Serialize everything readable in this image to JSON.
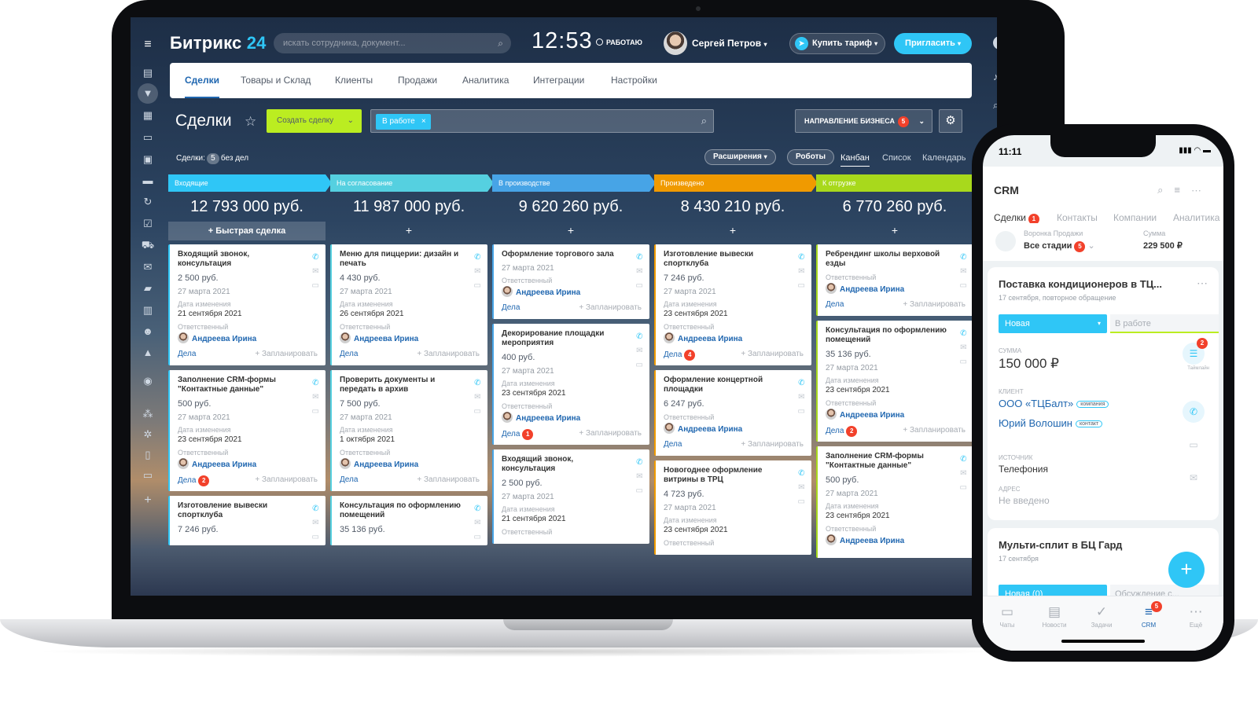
{
  "app": {
    "logo_main": "Битрикс",
    "logo_num": "24",
    "search_placeholder": "искать сотрудника, документ...",
    "clock": "12:53",
    "work_status": "РАБОТАЮ",
    "user_name": "Сергей Петров",
    "buy_tariff": "Купить тариф",
    "invite": "Пригласить",
    "help": "?"
  },
  "tabs": [
    "Сделки",
    "Товары и Склад",
    "Клиенты",
    "Продажи",
    "Аналитика",
    "Интеграции",
    "Настройки"
  ],
  "toolbar": {
    "title": "Сделки",
    "create_deal": "Создать сделку",
    "filter_chip": "В работе",
    "direction": "НАПРАВЛЕНИЕ БИЗНЕСА",
    "direction_badge": "5"
  },
  "subbar": {
    "deals_label": "Сделки:",
    "deals_count": "5",
    "deals_suffix": "без дел",
    "extensions": "Расширения",
    "robots": "Роботы",
    "views": [
      "Канбан",
      "Список",
      "Календарь"
    ]
  },
  "colors": {
    "accent": "#2fc6f6",
    "create": "#bbed21",
    "link": "#2067b0",
    "badge": "#f2412b"
  },
  "columns": [
    {
      "name": "Входящие",
      "color": "#2fc6f6",
      "sum": "12 793 000 руб.",
      "add": "+ Быстрая сделка",
      "cards": [
        {
          "title": "Входящий звонок, консультация",
          "price": "2 500 руб.",
          "date": "27 марта 2021",
          "changed_label": "Дата изменения",
          "changed": "21 сентября 2021",
          "resp_label": "Ответственный",
          "resp": "Андреева Ирина",
          "tasks": "Дела",
          "badge": "",
          "plan": "+ Запланировать"
        },
        {
          "title": "Заполнение CRM-формы \"Контактные данные\"",
          "price": "500 руб.",
          "date": "27 марта 2021",
          "changed_label": "Дата изменения",
          "changed": "23 сентября 2021",
          "resp_label": "Ответственный",
          "resp": "Андреева Ирина",
          "tasks": "Дела",
          "badge": "2",
          "plan": "+ Запланировать"
        },
        {
          "title": "Изготовление вывески спортклуба",
          "price": "7 246 руб.",
          "date": "",
          "changed_label": "",
          "changed": "",
          "resp_label": "",
          "resp": "",
          "tasks": "",
          "badge": "",
          "plan": ""
        }
      ]
    },
    {
      "name": "На согласование",
      "color": "#55d0e0",
      "sum": "11 987 000 руб.",
      "add": "+",
      "cards": [
        {
          "title": "Меню для пиццерии: дизайн и печать",
          "price": "4 430 руб.",
          "date": "27 марта 2021",
          "changed_label": "Дата изменения",
          "changed": "26 сентября 2021",
          "resp_label": "Ответственный",
          "resp": "Андреева Ирина",
          "tasks": "Дела",
          "badge": "",
          "plan": "+ Запланировать"
        },
        {
          "title": "Проверить документы и передать в архив",
          "price": "7 500 руб.",
          "date": "27 марта 2021",
          "changed_label": "Дата изменения",
          "changed": "1 октября 2021",
          "resp_label": "Ответственный",
          "resp": "Андреева Ирина",
          "tasks": "Дела",
          "badge": "",
          "plan": "+ Запланировать"
        },
        {
          "title": "Консультация по оформлению помещений",
          "price": "35 136 руб.",
          "date": "",
          "changed_label": "",
          "changed": "",
          "resp_label": "",
          "resp": "",
          "tasks": "",
          "badge": "",
          "plan": ""
        }
      ]
    },
    {
      "name": "В производстве",
      "color": "#47a4e6",
      "sum": "9 620 260 руб.",
      "add": "+",
      "cards": [
        {
          "title": "Оформление торгового зала",
          "price": "",
          "date": "27 марта 2021",
          "changed_label": "",
          "changed": "",
          "resp_label": "Ответственный",
          "resp": "Андреева Ирина",
          "tasks": "Дела",
          "badge": "",
          "plan": "+ Запланировать"
        },
        {
          "title": "Декорирование площадки мероприятия",
          "price": "400 руб.",
          "date": "27 марта 2021",
          "changed_label": "Дата изменения",
          "changed": "23 сентября 2021",
          "resp_label": "Ответственный",
          "resp": "Андреева Ирина",
          "tasks": "Дела",
          "badge": "1",
          "plan": "+ Запланировать"
        },
        {
          "title": "Входящий звонок, консультация",
          "price": "2 500 руб.",
          "date": "27 марта 2021",
          "changed_label": "Дата изменения",
          "changed": "21 сентября 2021",
          "resp_label": "Ответственный",
          "resp": "",
          "tasks": "",
          "badge": "",
          "plan": ""
        }
      ]
    },
    {
      "name": "Произведено",
      "color": "#f09a00",
      "sum": "8 430 210 руб.",
      "add": "+",
      "cards": [
        {
          "title": "Изготовление вывески спортклуба",
          "price": "7 246 руб.",
          "date": "27 марта 2021",
          "changed_label": "Дата изменения",
          "changed": "23 сентября 2021",
          "resp_label": "Ответственный",
          "resp": "Андреева Ирина",
          "tasks": "Дела",
          "badge": "4",
          "plan": "+ Запланировать"
        },
        {
          "title": "Оформление концертной площадки",
          "price": "6 247 руб.",
          "date": "",
          "changed_label": "",
          "changed": "",
          "resp_label": "Ответственный",
          "resp": "Андреева Ирина",
          "tasks": "Дела",
          "badge": "",
          "plan": "+ Запланировать"
        },
        {
          "title": "Новогоднее оформление витрины в ТРЦ",
          "price": "4 723 руб.",
          "date": "27 марта 2021",
          "changed_label": "Дата изменения",
          "changed": "23 сентября 2021",
          "resp_label": "Ответственный",
          "resp": "",
          "tasks": "",
          "badge": "",
          "plan": ""
        }
      ]
    },
    {
      "name": "К отгрузке",
      "color": "#a8d91c",
      "sum": "6 770 260 руб.",
      "add": "+",
      "cards": [
        {
          "title": "Ребрендинг школы верховой езды",
          "price": "",
          "date": "",
          "changed_label": "",
          "changed": "",
          "resp_label": "Ответственный",
          "resp": "Андреева Ирина",
          "tasks": "Дела",
          "badge": "",
          "plan": "+ Запланировать"
        },
        {
          "title": "Консультация по оформлению помещений",
          "price": "35 136 руб.",
          "date": "27 марта 2021",
          "changed_label": "Дата изменения",
          "changed": "23 сентября 2021",
          "resp_label": "Ответственный",
          "resp": "Андреева Ирина",
          "tasks": "Дела",
          "badge": "2",
          "plan": "+ Запланировать"
        },
        {
          "title": "Заполнение CRM-формы \"Контактные данные\"",
          "price": "500 руб.",
          "date": "27 марта 2021",
          "changed_label": "Дата изменения",
          "changed": "23 сентября 2021",
          "resp_label": "Ответственный",
          "resp": "Андреева Ирина",
          "tasks": "",
          "badge": "",
          "plan": ""
        }
      ]
    }
  ],
  "phone": {
    "time": "11:11",
    "title": "CRM",
    "tabs": [
      "Сделки",
      "Контакты",
      "Компании",
      "Аналитика"
    ],
    "tab_badge": "1",
    "funnel_label": "Воронка Продажи",
    "funnel_value": "Все стадии",
    "funnel_badge": "5",
    "sum_label": "Сумма",
    "sum_value": "229 500 ₽",
    "deal1": {
      "title": "Поставка кондиционеров в ТЦ...",
      "date": "17 сентября, повторное обращение",
      "stage": "Новая",
      "next_stage": "В работе",
      "sum_label": "СУММА",
      "sum": "150 000 ₽",
      "client_label": "КЛИЕНТ",
      "company": "ООО «ТЦБалт»",
      "company_tag": "компания",
      "contact": "Юрий Волошин",
      "contact_tag": "контакт",
      "source_label": "ИСТОЧНИК",
      "source": "Телефония",
      "address_label": "АДРЕС",
      "address": "Не введено",
      "side_badge": "2",
      "side_caption": "Таймлайн"
    },
    "deal2": {
      "title": "Мульти-сплит в БЦ Гард",
      "date": "17 сентября",
      "stage": "Новая (0)",
      "next_stage": "Обсуждение с..."
    },
    "nav": [
      "Чаты",
      "Новости",
      "Задачи",
      "CRM",
      "Ещё"
    ],
    "nav_badge": "5"
  }
}
